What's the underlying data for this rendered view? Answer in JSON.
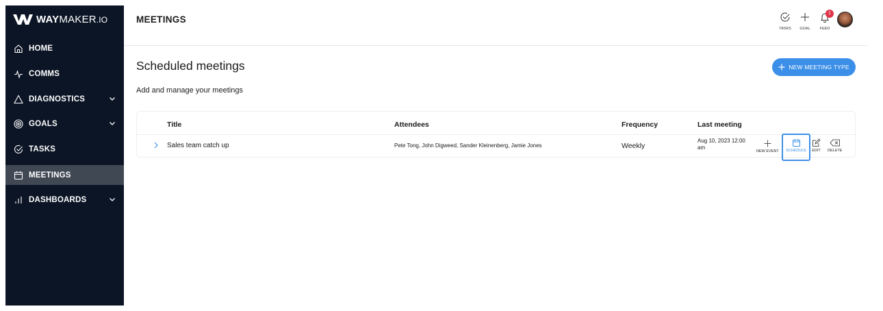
{
  "brand": {
    "bold": "WAY",
    "light": "MAKER",
    "suffix": ".IO"
  },
  "sidebar": {
    "items": [
      {
        "label": "HOME",
        "icon": "home-icon",
        "chevron": false,
        "active": false
      },
      {
        "label": "COMMS",
        "icon": "pulse-icon",
        "chevron": false,
        "active": false
      },
      {
        "label": "DIAGNOSTICS",
        "icon": "triangle-icon",
        "chevron": true,
        "active": false
      },
      {
        "label": "GOALS",
        "icon": "target-icon",
        "chevron": true,
        "active": false
      },
      {
        "label": "TASKS",
        "icon": "check-circle-icon",
        "chevron": false,
        "active": false
      },
      {
        "label": "MEETINGS",
        "icon": "calendar-icon",
        "chevron": false,
        "active": true
      },
      {
        "label": "DASHBOARDS",
        "icon": "bar-chart-icon",
        "chevron": true,
        "active": false
      }
    ]
  },
  "header": {
    "title": "MEETINGS",
    "actions": [
      {
        "label": "TASKS",
        "icon": "check-circle-icon"
      },
      {
        "label": "GOAL",
        "icon": "plus-icon"
      },
      {
        "label": "FEED",
        "icon": "bell-icon",
        "badge": "1"
      }
    ]
  },
  "main": {
    "title": "Scheduled meetings",
    "subtitle": "Add and manage your meetings",
    "new_button_label": "NEW MEETING TYPE"
  },
  "table": {
    "columns": [
      "Title",
      "Attendees",
      "Frequency",
      "Last meeting"
    ],
    "rows": [
      {
        "title": "Sales team catch up",
        "attendees": "Pete Tong, John Digweed, Sander Kleinenberg, Jamie Jones",
        "frequency": "Weekly",
        "last_meeting_line1": "Aug 10, 2023 12:00",
        "last_meeting_line2": "am"
      }
    ],
    "row_actions": [
      "NEW EVENT",
      "SCHEDULE",
      "EDIT",
      "DELETE"
    ]
  },
  "colors": {
    "sidebar_bg": "#0c1526",
    "sidebar_active": "#404854",
    "accent": "#3b8fe8",
    "badge": "#e0344a"
  }
}
